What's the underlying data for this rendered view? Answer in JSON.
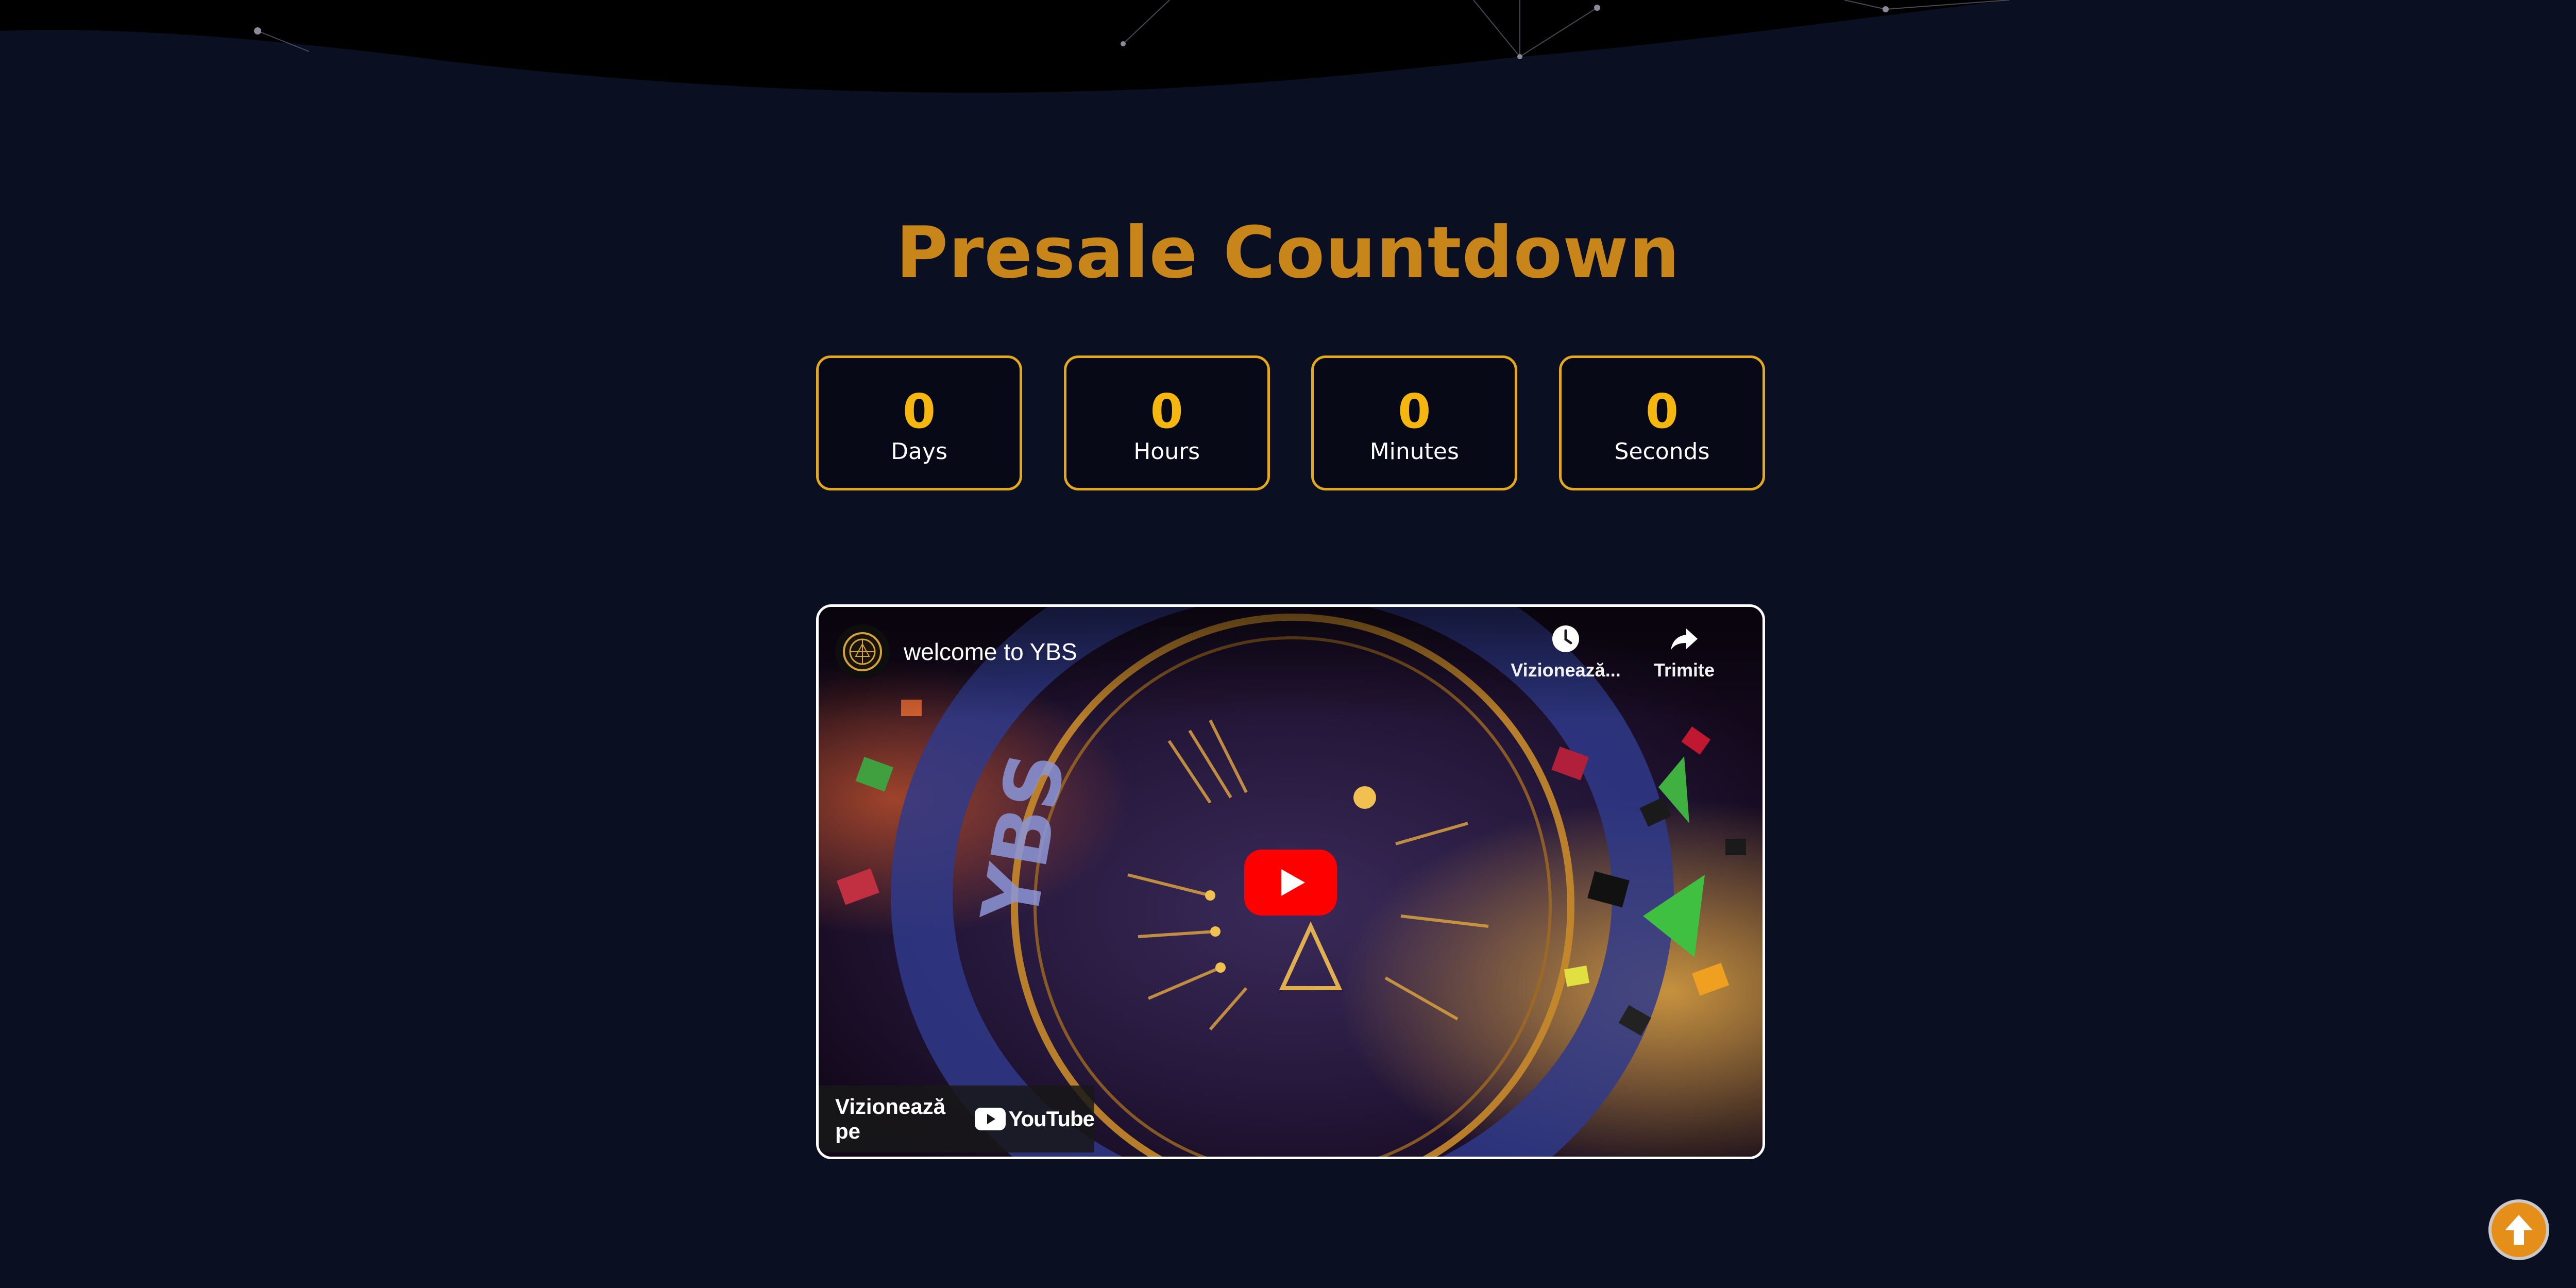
{
  "page": {
    "title": "Presale Countdown"
  },
  "countdown": [
    {
      "value": "0",
      "label": "Days"
    },
    {
      "value": "0",
      "label": "Hours"
    },
    {
      "value": "0",
      "label": "Minutes"
    },
    {
      "value": "0",
      "label": "Seconds"
    }
  ],
  "video": {
    "title": "welcome to YBS",
    "watch_later": "Vizionează...",
    "share": "Trimite",
    "watch_on": "Vizionează pe",
    "platform": "YouTube",
    "thumbnail_text": "YBS"
  },
  "colors": {
    "background": "#0a1022",
    "title": "#c8861a",
    "accent": "#e3a81c",
    "value": "#f5b70f",
    "play": "#ff0000",
    "scroll_button": "#e58e1a"
  },
  "icons": [
    "clock-icon",
    "share-icon",
    "play-icon",
    "youtube-logo",
    "arrow-up-icon",
    "channel-avatar"
  ]
}
